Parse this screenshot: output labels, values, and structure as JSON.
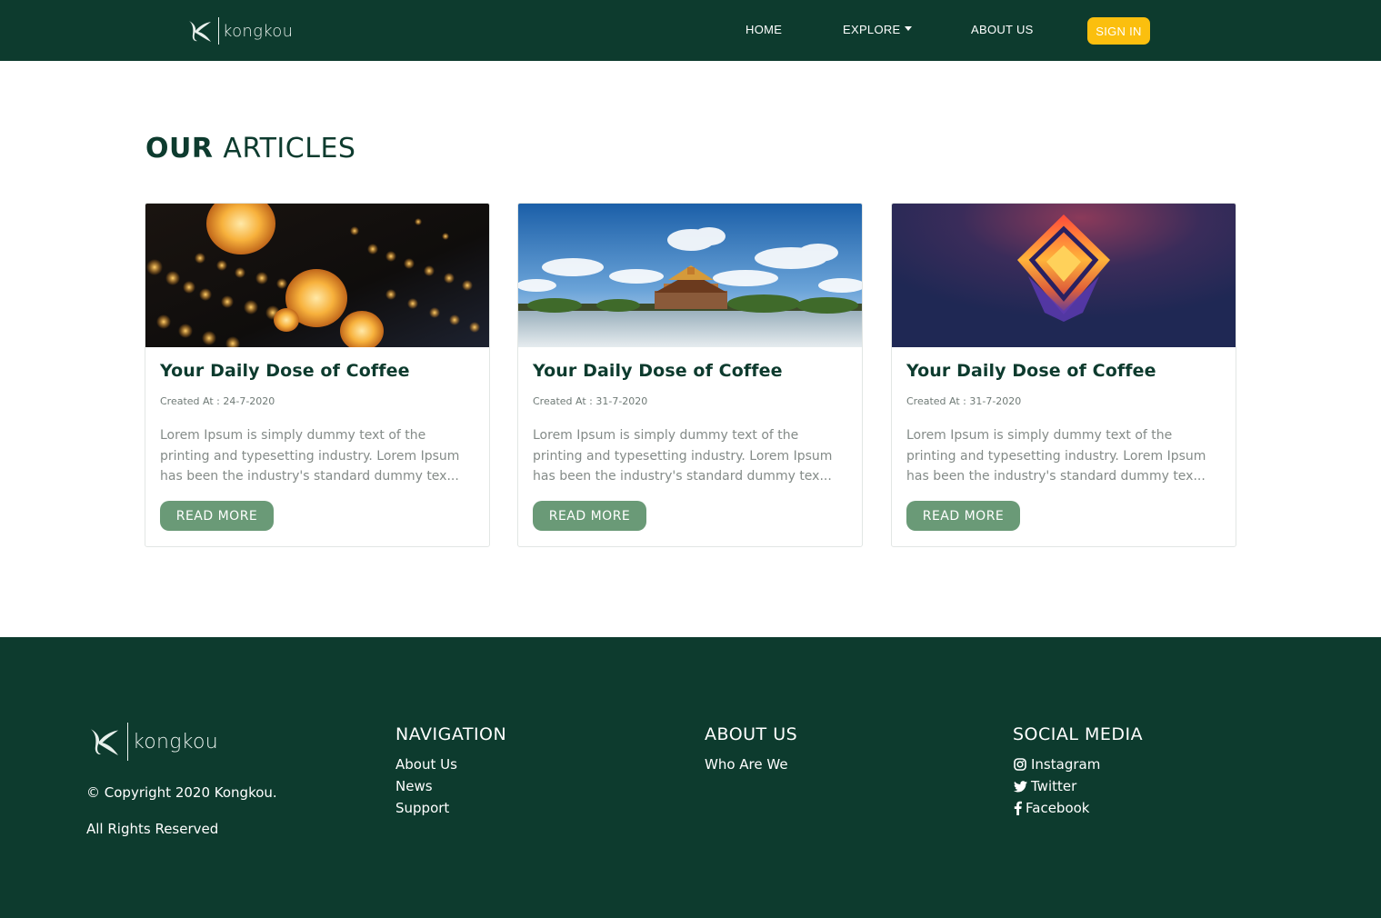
{
  "header": {
    "brand": "kongkou",
    "nav": {
      "home": "HOME",
      "explore": "EXPLORE",
      "about": "ABOUT US",
      "signin": "SIGN IN"
    }
  },
  "articles": {
    "title_bold": "OUR",
    "title_rest": "ARTICLES",
    "items": [
      {
        "title": "Your Daily Dose of Coffee",
        "date": "Created At : 24-7-2020",
        "excerpt": "Lorem Ipsum is simply dummy text of the printing and typesetting industry. Lorem Ipsum has been the industry's standard dummy tex...",
        "button": "READ MORE",
        "image": "lanterns-photo"
      },
      {
        "title": "Your Daily Dose of Coffee",
        "date": "Created At : 31-7-2020",
        "excerpt": "Lorem Ipsum is simply dummy text of the printing and typesetting industry. Lorem Ipsum has been the industry's standard dummy tex...",
        "button": "READ MORE",
        "image": "palace-photo"
      },
      {
        "title": "Your Daily Dose of Coffee",
        "date": "Created At : 31-7-2020",
        "excerpt": "Lorem Ipsum is simply dummy text of the printing and typesetting industry. Lorem Ipsum has been the industry's standard dummy tex...",
        "button": "READ MORE",
        "image": "abstract-art"
      }
    ]
  },
  "footer": {
    "brand": "kongkou",
    "copyright": "© Copyright 2020 Kongkou.",
    "rights": "All Rights Reserved",
    "navigation": {
      "heading": "NAVIGATION",
      "links": [
        "About Us",
        "News",
        "Support"
      ]
    },
    "about": {
      "heading": "ABOUT US",
      "links": [
        "Who Are We"
      ]
    },
    "social": {
      "heading": "SOCIAL MEDIA",
      "links": [
        {
          "icon": "instagram-icon",
          "label": "Instagram"
        },
        {
          "icon": "twitter-icon",
          "label": "Twitter"
        },
        {
          "icon": "facebook-icon",
          "label": "Facebook"
        }
      ]
    }
  },
  "colors": {
    "primary": "#0d3b2e",
    "accent": "#fbbf0e",
    "button": "#6a9a77"
  }
}
